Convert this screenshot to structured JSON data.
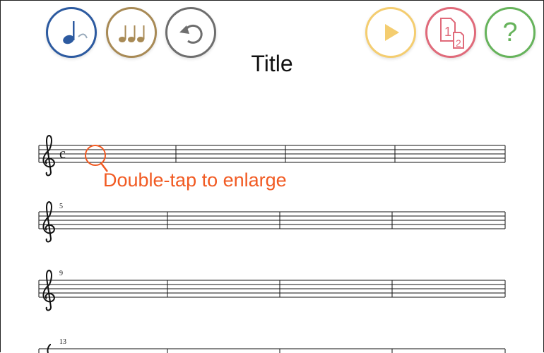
{
  "toolbar": {
    "note_input": {
      "icon": "quarter-note-icon",
      "color": "#2c5aa0"
    },
    "rhythm": {
      "icon": "three-notes-icon",
      "color": "#a88a55"
    },
    "undo": {
      "icon": "undo-icon",
      "color": "#6e6e6e"
    },
    "play": {
      "icon": "play-icon",
      "color": "#f4cd70"
    },
    "pages": {
      "icon": "pages-icon",
      "color": "#e06a7a",
      "page_a": "1",
      "page_b": "2"
    },
    "help": {
      "icon": "help-icon",
      "color": "#66b35b",
      "label": "?"
    }
  },
  "score": {
    "title": "Title",
    "time_signature": "c",
    "systems": [
      {
        "measure_number": ""
      },
      {
        "measure_number": "5"
      },
      {
        "measure_number": "9"
      },
      {
        "measure_number": "13"
      }
    ]
  },
  "hint": {
    "text": "Double-tap to enlarge",
    "icon": "magnifier-icon",
    "color": "#f15a22"
  }
}
